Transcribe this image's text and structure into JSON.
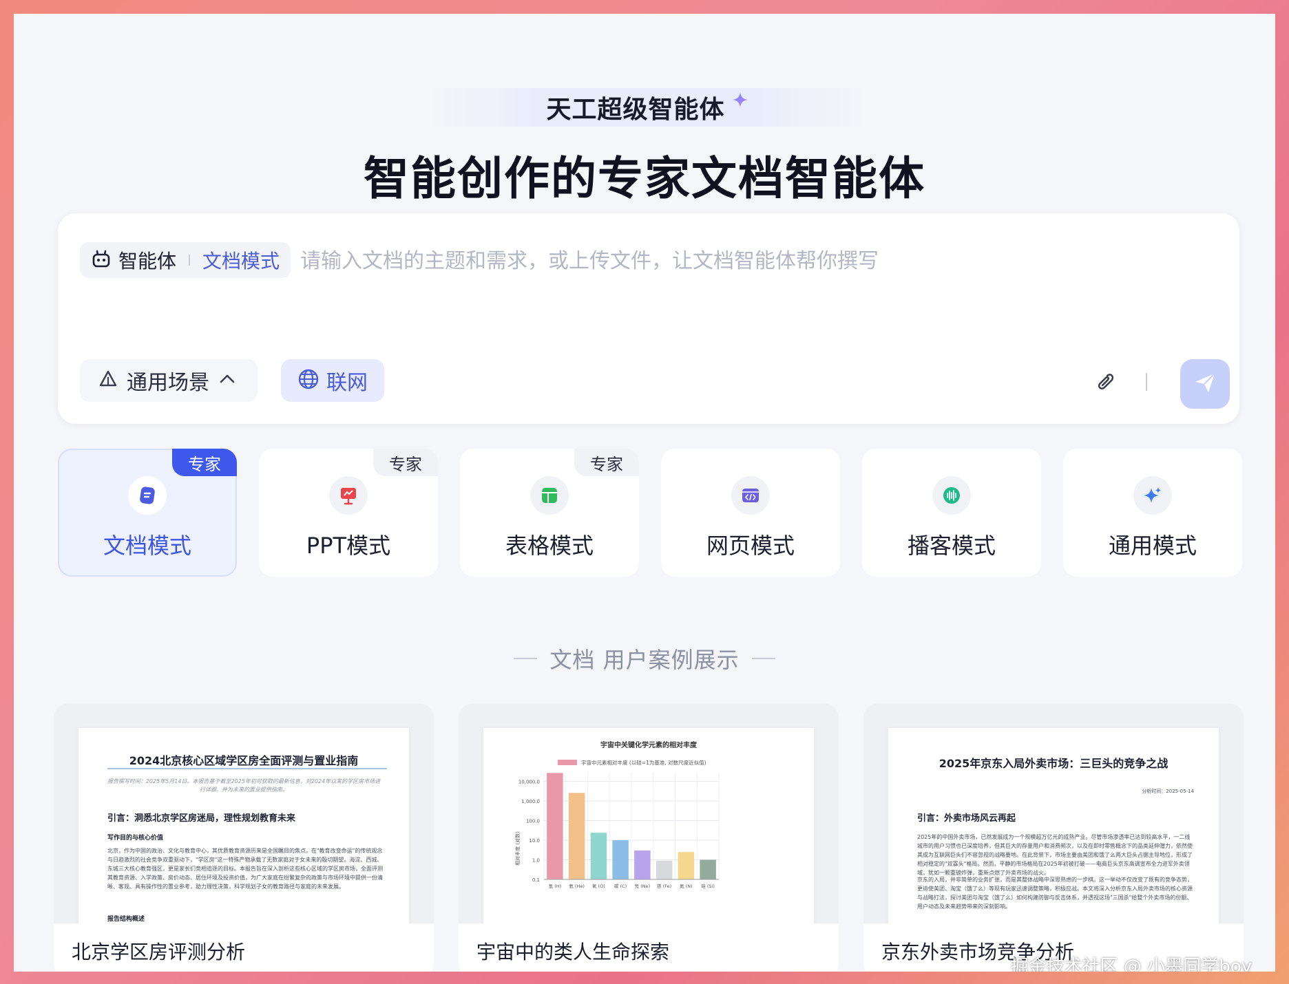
{
  "hero": {
    "badge": "天工超级智能体",
    "title": "智能创作的专家文档智能体"
  },
  "input": {
    "agent_label": "智能体",
    "mode_label": "文档模式",
    "placeholder": "请输入文档的主题和需求，或上传文件，让文档智能体帮你撰写",
    "scene_label": "通用场景",
    "web_label": "联网"
  },
  "modes": [
    {
      "name": "文档模式",
      "tag": "专家",
      "icon": "document-icon",
      "color": "#4c5be0"
    },
    {
      "name": "PPT模式",
      "tag": "专家",
      "icon": "ppt-icon",
      "color": "#e9454d"
    },
    {
      "name": "表格模式",
      "tag": "专家",
      "icon": "table-icon",
      "color": "#2fba5c"
    },
    {
      "name": "网页模式",
      "tag": "",
      "icon": "code-icon",
      "color": "#6c5fe0"
    },
    {
      "name": "播客模式",
      "tag": "",
      "icon": "audio-icon",
      "color": "#1fba8a"
    },
    {
      "name": "通用模式",
      "tag": "",
      "icon": "sparkle-icon",
      "color": "#3d7cf0"
    }
  ],
  "section": {
    "title": "文档 用户案例展示"
  },
  "cases": [
    {
      "caption": "北京学区房评测分析",
      "doc_title": "2024北京核心区域学区房全面评测与置业指南",
      "doc_sub": "报告撰写时间：2025年5月14日。本报告基于截至2025年初可获取的最新信息，对2024年以来的学区房市场进行详细、并为未来的置业提供指南。",
      "h1": "引言：洞悉北京学区房迷局，理性规划教育未来",
      "h2": "写作目的与核心价值",
      "p1": "北京，作为中国的政治、文化与教育中心，其优质教育资源历来是全国瞩目的焦点。在\"教育改变命运\"的传统观念与日趋激烈的社会竞争双重驱动下，\"学区房\"这一特殊产物承载了无数家庭对于女未来的殷切期望。海淀、西城、东城三大核心教育强区，更是家长们竞相追逐的目标。本报告旨在深入剖析这些核心区域的学区房市场，全面评测其教育资源、入学政策、房价动态、居住环境及投资价值，为广大家庭在纷繁复杂的政策与市场环境中提供一份清晰、客观、具有操作性的置业参考，助力理性决策，科学规划子女的教育路径与家庭的未来发展。",
      "h3": "报告结构概述"
    },
    {
      "caption": "宇宙中的类人生命探索"
    },
    {
      "caption": "京东外卖市场竞争分析",
      "doc_title": "2025年京东入局外卖市场：三巨头的竞争之战",
      "meta": "分析时间：2025-05-14",
      "h1": "引言：外卖市场风云再起",
      "p1": "2025年的中国外卖市场，已然发展成为一个规模超万亿元的成熟产业。尽管市场渗透率已达到较高水平，一二线城市的用户习惯也已深度培养，但其巨大的存量用户和消费频次，以及在即时零售概念下的品类延伸潜力，依然使其成为互联网巨头们不容忽视的战略要地。在此背景下，市场主要由美团和饿了么两大巨头占据主导地位，形成了相对稳定的\"双寡头\"格局。然而，平静的市场格局在2025年初被打破——电商巨头京东高调宣布全力进军外卖领域，犹如一颗重磅炸弹，重新点燃了外卖市场的战火。",
      "p2": "京东的入局，并非简单的业务扩张，而是其整体战略中深思熟虑的一步棋。这一举动不仅改变了既有的竞争态势，更迫使美团、淘宝（饿了么）等现有玩家迅速调整策略，积极应战。本文将深入分析京东入局外卖市场的核心资源与战略打法，探讨美团与淘宝（饿了么）如何构建防御与反击体系，并透视这场\"三国杀\"给整个外卖市场的份额、用户动态及未来趋势带来的深刻影响。"
    }
  ],
  "chart_data": {
    "type": "bar",
    "title": "宇宙中关键化学元素的相对丰度",
    "legend": "宇宙中元素相对丰度 (以硅=1为基准, 对数尺度近似值)",
    "ylabel": "相对丰度 (对数)",
    "yscale": "log",
    "ylim": [
      0.1,
      30000
    ],
    "yticks": [
      "0.1",
      "1.0",
      "10.0",
      "100.0",
      "1,000.0",
      "10,000.0"
    ],
    "categories": [
      "氢 (H)",
      "氦 (He)",
      "氧 (O)",
      "碳 (C)",
      "氖 (Ne)",
      "铁 (Fe)",
      "氮 (N)",
      "硅 (Si)"
    ],
    "values": [
      27000,
      2600,
      24,
      10,
      3,
      0.9,
      2.5,
      1.0
    ],
    "colors": [
      "#e89aaa",
      "#f2c088",
      "#8fd6d0",
      "#8cbde8",
      "#b9a3ee",
      "#d8d9dc",
      "#f5d88e",
      "#93aa9e"
    ]
  },
  "watermark": "掘金技术社区 @ 小墨同学boy"
}
